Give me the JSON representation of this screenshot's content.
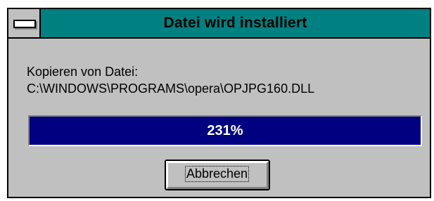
{
  "window": {
    "title": "Datei wird installiert",
    "title_bar_color": "#008080",
    "system_menu_icon": "minus-bar-icon"
  },
  "content": {
    "label": "Kopieren von Datei:",
    "file_path": "C:\\WINDOWS\\PROGRAMS\\opera\\OPJPG160.DLL"
  },
  "progress": {
    "text": "231%",
    "fill_percent": 100,
    "fill_color": "#000080"
  },
  "buttons": {
    "cancel_label": "Abbrechen"
  }
}
